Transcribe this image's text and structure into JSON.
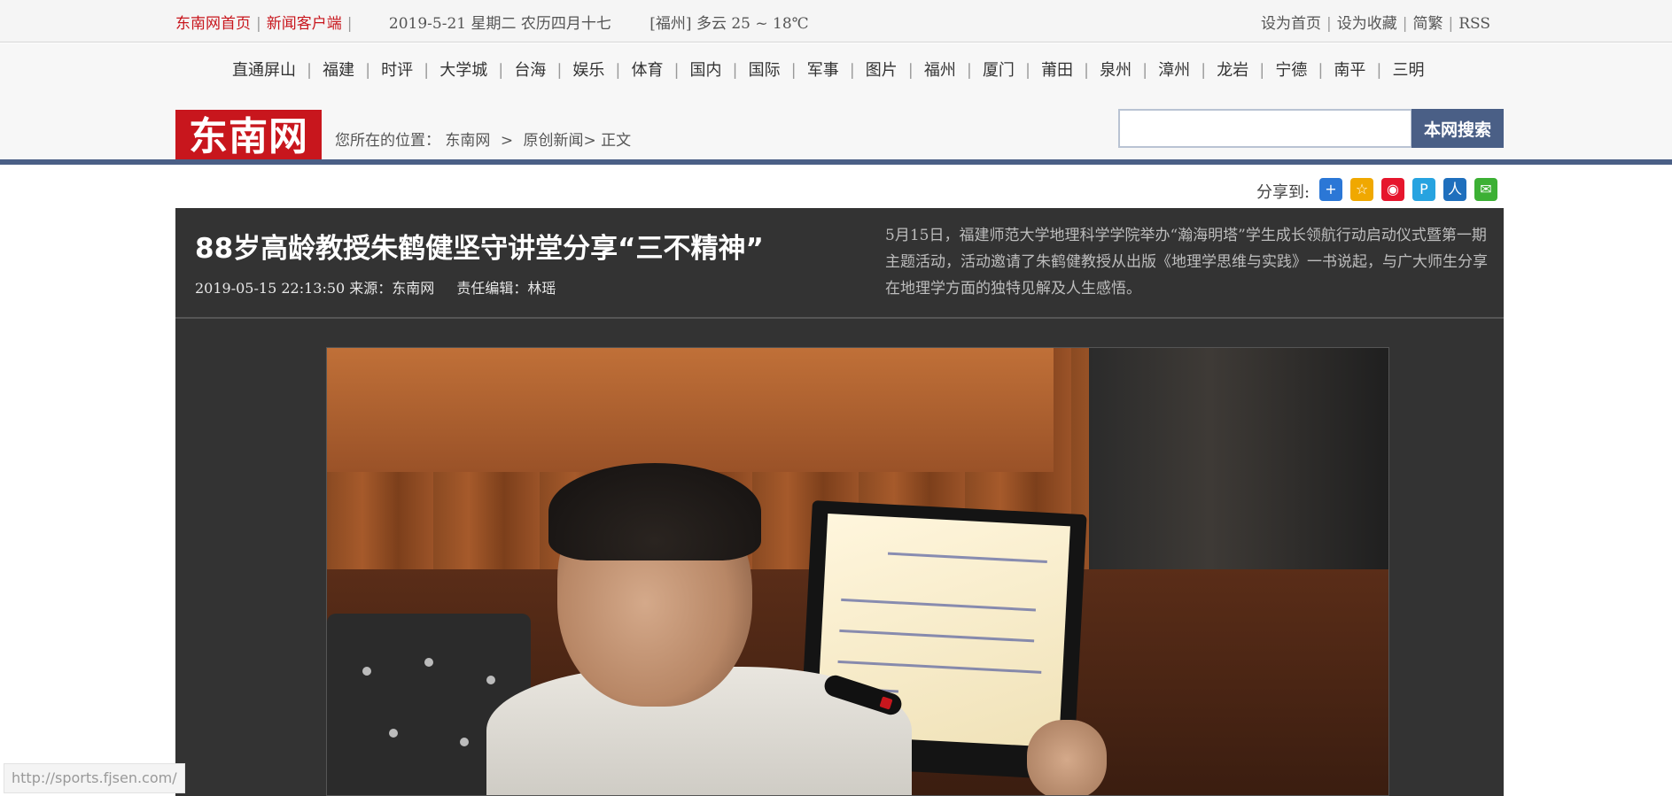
{
  "topbar": {
    "home_link": "东南网首页",
    "client_link": "新闻客户端",
    "date": "2019-5-21 星期二 农历四月十七",
    "weather": "[福州] 多云 25 ~ 18℃",
    "right_links": [
      "设为首页",
      "设为收藏",
      "简繁",
      "RSS"
    ]
  },
  "nav": {
    "items": [
      "直通屏山",
      "福建",
      "时评",
      "大学城",
      "台海",
      "娱乐",
      "体育",
      "国内",
      "国际",
      "军事",
      "图片",
      "福州",
      "厦门",
      "莆田",
      "泉州",
      "漳州",
      "龙岩",
      "宁德",
      "南平",
      "三明"
    ]
  },
  "logo": {
    "text": "东南网"
  },
  "breadcrumb": {
    "label": "您所在的位置：",
    "site": "东南网",
    "arrow": ">",
    "section": "原创新闻>",
    "current": "正文"
  },
  "search": {
    "button_label": "本网搜索",
    "value": ""
  },
  "share": {
    "label": "分享到:",
    "icons": [
      {
        "name": "qzone-share-icon",
        "color": "#2b77d6",
        "glyph": "+"
      },
      {
        "name": "favorite-share-icon",
        "color": "#f0a800",
        "glyph": "☆"
      },
      {
        "name": "weibo-share-icon",
        "color": "#e6162d",
        "glyph": "◉"
      },
      {
        "name": "pengyou-share-icon",
        "color": "#27a3e0",
        "glyph": "P"
      },
      {
        "name": "renren-share-icon",
        "color": "#1f6fbd",
        "glyph": "人"
      },
      {
        "name": "wechat-share-icon",
        "color": "#3cb034",
        "glyph": "✉"
      }
    ]
  },
  "article": {
    "title": "88岁高龄教授朱鹤健坚守讲堂分享“三不精神”",
    "datetime": "2019-05-15 22:13:50",
    "source": "来源：东南网",
    "editor": "责任编辑：林瑶",
    "summary": "5月15日，福建师范大学地理科学学院举办“瀚海明塔”学生成长领航行动启动仪式暨第一期主题活动，活动邀请了朱鹤健教授从出版《地理学思维与实践》一书说起，与广大师生分享在地理学方面的独特见解及人生感悟。"
  },
  "status_bar": {
    "url": "http://sports.fjsen.com/"
  }
}
